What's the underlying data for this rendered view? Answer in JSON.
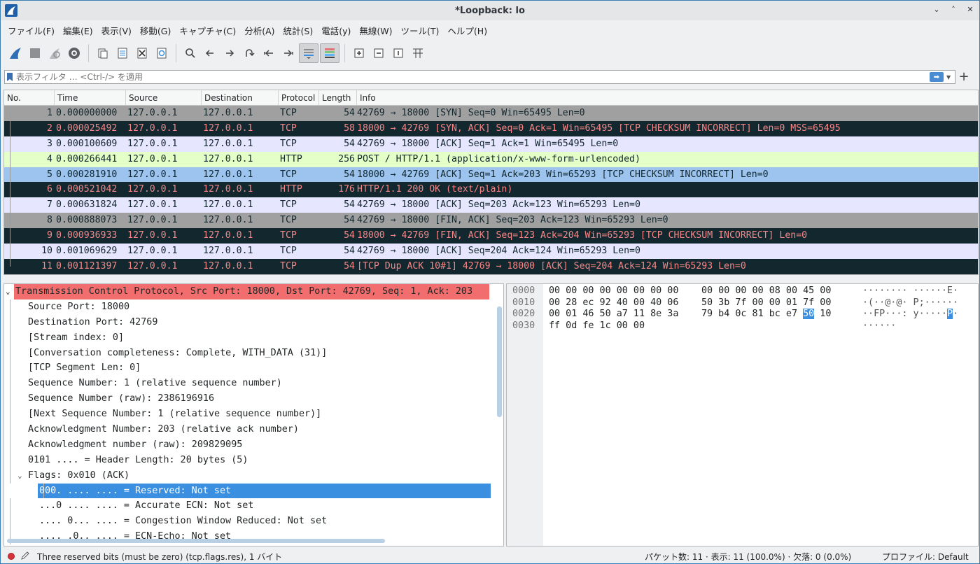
{
  "window": {
    "title": "*Loopback: lo"
  },
  "window_controls": [
    "⌄",
    "˄",
    "✕"
  ],
  "menu": [
    "ファイル(F)",
    "編集(E)",
    "表示(V)",
    "移動(G)",
    "キャプチャ(C)",
    "分析(A)",
    "統計(S)",
    "電話(y)",
    "無線(W)",
    "ツール(T)",
    "ヘルプ(H)"
  ],
  "toolbar_icons": [
    "shark-fin-start-icon",
    "stop-icon",
    "restart-icon",
    "capture-options-icon",
    "open-file-icon",
    "save-file-icon",
    "close-file-icon",
    "reload-icon",
    "find-icon",
    "go-back-icon",
    "go-forward-icon",
    "go-to-packet-icon",
    "first-packet-icon",
    "last-packet-icon",
    "autoscroll-icon",
    "colorize-icon",
    "zoom-in-icon",
    "zoom-out-icon",
    "normal-size-icon",
    "resize-columns-icon"
  ],
  "filter": {
    "placeholder": "表示フィルタ … <Ctrl-/> を適用",
    "value": ""
  },
  "packet_list": {
    "columns": [
      "No.",
      "Time",
      "Source",
      "Destination",
      "Protocol",
      "Length",
      "Info"
    ],
    "rows": [
      {
        "no": "1",
        "time": "0.000000000",
        "src": "127.0.0.1",
        "dst": "127.0.0.1",
        "proto": "TCP",
        "len": "54",
        "info": "42769 → 18000 [SYN] Seq=0 Win=65495 Len=0",
        "bg": "#a0a0a0",
        "fg": "#12272e"
      },
      {
        "no": "2",
        "time": "0.000025492",
        "src": "127.0.0.1",
        "dst": "127.0.0.1",
        "proto": "TCP",
        "len": "58",
        "info": "18000 → 42769 [SYN, ACK] Seq=0 Ack=1 Win=65495 [TCP CHECKSUM INCORRECT] Len=0 MSS=65495",
        "bg": "#12272e",
        "fg": "#f78787"
      },
      {
        "no": "3",
        "time": "0.000100609",
        "src": "127.0.0.1",
        "dst": "127.0.0.1",
        "proto": "TCP",
        "len": "54",
        "info": "42769 → 18000 [ACK] Seq=1 Ack=1 Win=65495 Len=0",
        "bg": "#e7e6ff",
        "fg": "#12272e"
      },
      {
        "no": "4",
        "time": "0.000266441",
        "src": "127.0.0.1",
        "dst": "127.0.0.1",
        "proto": "HTTP",
        "len": "256",
        "info": "POST / HTTP/1.1  (application/x-www-form-urlencoded)",
        "bg": "#e4ffc7",
        "fg": "#12272e"
      },
      {
        "no": "5",
        "time": "0.000281910",
        "src": "127.0.0.1",
        "dst": "127.0.0.1",
        "proto": "TCP",
        "len": "54",
        "info": "18000 → 42769 [ACK] Seq=1 Ack=203 Win=65293 [TCP CHECKSUM INCORRECT] Len=0",
        "bg": "#9cc4ee",
        "fg": "#12272e"
      },
      {
        "no": "6",
        "time": "0.000521042",
        "src": "127.0.0.1",
        "dst": "127.0.0.1",
        "proto": "HTTP",
        "len": "176",
        "info": "HTTP/1.1 200 OK  (text/plain)",
        "bg": "#12272e",
        "fg": "#f78787"
      },
      {
        "no": "7",
        "time": "0.000631824",
        "src": "127.0.0.1",
        "dst": "127.0.0.1",
        "proto": "TCP",
        "len": "54",
        "info": "42769 → 18000 [ACK] Seq=203 Ack=123 Win=65293 Len=0",
        "bg": "#e7e6ff",
        "fg": "#12272e"
      },
      {
        "no": "8",
        "time": "0.000888073",
        "src": "127.0.0.1",
        "dst": "127.0.0.1",
        "proto": "TCP",
        "len": "54",
        "info": "42769 → 18000 [FIN, ACK] Seq=203 Ack=123 Win=65293 Len=0",
        "bg": "#a0a0a0",
        "fg": "#12272e"
      },
      {
        "no": "9",
        "time": "0.000936933",
        "src": "127.0.0.1",
        "dst": "127.0.0.1",
        "proto": "TCP",
        "len": "54",
        "info": "18000 → 42769 [FIN, ACK] Seq=123 Ack=204 Win=65293 [TCP CHECKSUM INCORRECT] Len=0",
        "bg": "#12272e",
        "fg": "#f78787"
      },
      {
        "no": "10",
        "time": "0.001069629",
        "src": "127.0.0.1",
        "dst": "127.0.0.1",
        "proto": "TCP",
        "len": "54",
        "info": "42769 → 18000 [ACK] Seq=204 Ack=124 Win=65293 Len=0",
        "bg": "#e7e6ff",
        "fg": "#12272e"
      },
      {
        "no": "11",
        "time": "0.001121397",
        "src": "127.0.0.1",
        "dst": "127.0.0.1",
        "proto": "TCP",
        "len": "54",
        "info": "[TCP Dup ACK 10#1] 42769 → 18000 [ACK] Seq=204 Ack=124 Win=65293 Len=0",
        "bg": "#12272e",
        "fg": "#f78787"
      }
    ]
  },
  "detail_tree": [
    {
      "text": "Transmission Control Protocol, Src Port: 18000, Dst Port: 42769, Seq: 1, Ack: 203",
      "level": 0,
      "expander": "⌄",
      "style": "top"
    },
    {
      "text": "Source Port: 18000",
      "level": 1,
      "expander": "",
      "style": ""
    },
    {
      "text": "Destination Port: 42769",
      "level": 1,
      "expander": "",
      "style": ""
    },
    {
      "text": "[Stream index: 0]",
      "level": 1,
      "expander": "",
      "style": ""
    },
    {
      "text": "[Conversation completeness: Complete, WITH_DATA (31)]",
      "level": 1,
      "expander": "",
      "style": ""
    },
    {
      "text": "[TCP Segment Len: 0]",
      "level": 1,
      "expander": "",
      "style": ""
    },
    {
      "text": "Sequence Number: 1    (relative sequence number)",
      "level": 1,
      "expander": "",
      "style": ""
    },
    {
      "text": "Sequence Number (raw): 2386196916",
      "level": 1,
      "expander": "",
      "style": ""
    },
    {
      "text": "[Next Sequence Number: 1    (relative sequence number)]",
      "level": 1,
      "expander": "",
      "style": ""
    },
    {
      "text": "Acknowledgment Number: 203    (relative ack number)",
      "level": 1,
      "expander": "",
      "style": ""
    },
    {
      "text": "Acknowledgment number (raw): 209829095",
      "level": 1,
      "expander": "",
      "style": ""
    },
    {
      "text": "0101 .... = Header Length: 20 bytes (5)",
      "level": 1,
      "expander": "",
      "style": ""
    },
    {
      "text": "Flags: 0x010 (ACK)",
      "level": 1,
      "expander": "⌄",
      "style": ""
    },
    {
      "text": "000. .... .... = Reserved: Not set",
      "level": 2,
      "expander": "",
      "style": "sel"
    },
    {
      "text": "...0 .... .... = Accurate ECN: Not set",
      "level": 2,
      "expander": "",
      "style": ""
    },
    {
      "text": ".... 0... .... = Congestion Window Reduced: Not set",
      "level": 2,
      "expander": "",
      "style": ""
    },
    {
      "text": ".... .0.. .... = ECN-Echo: Not set",
      "level": 2,
      "expander": "",
      "style": ""
    }
  ],
  "hex_dump": [
    {
      "offset": "0000",
      "hex_a": "00 00 00 00 00 00 00 00",
      "hex_b": "00 00 00 00 08 00 45 00",
      "hex_b_hl": "",
      "hex_b_after": "",
      "ascii": "········ ······E·"
    },
    {
      "offset": "0010",
      "hex_a": "00 28 ec 92 40 00 40 06",
      "hex_b": "50 3b 7f 00 00 01 7f 00",
      "hex_b_hl": "",
      "hex_b_after": "",
      "ascii": "·(··@·@· P;······"
    },
    {
      "offset": "0020",
      "hex_a": "00 01 46 50 a7 11 8e 3a",
      "hex_b": "79 b4 0c 81 bc e7 ",
      "hex_b_hl": "50",
      "hex_b_after": " 10",
      "ascii": "··FP···: y·····",
      "ascii_hl": "P",
      "ascii_after": "·"
    },
    {
      "offset": "0030",
      "hex_a": "ff 0d fe 1c 00 00",
      "hex_b": "",
      "hex_b_hl": "",
      "hex_b_after": "",
      "ascii": "······"
    }
  ],
  "status": {
    "field_info": "Three reserved bits (must be zero) (tcp.flags.res), 1 バイト",
    "packets": "パケット数: 11 · 表示: 11 (100.0%) · 欠落: 0 (0.0%)",
    "profile": "プロファイル: Default"
  },
  "colors": {
    "accent": "#3b8fe0",
    "tcp_top": "#f26d6d"
  }
}
